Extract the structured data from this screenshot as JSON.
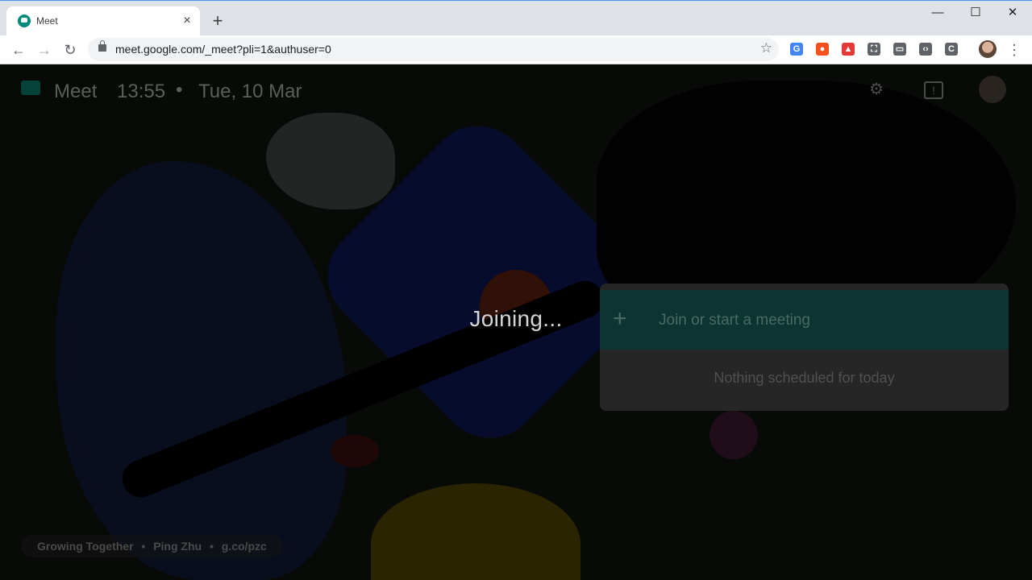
{
  "browser": {
    "tab_title": "Meet",
    "tab_close_icon": "×",
    "new_tab_icon": "+",
    "window_controls": {
      "minimize": "—",
      "maximize": "☐",
      "close": "✕"
    },
    "nav": {
      "back": "←",
      "forward": "→",
      "reload": "↻"
    },
    "url": "meet.google.com/_meet?pli=1&authuser=0",
    "bookmark_icon": "☆",
    "menu_icon": "⋮",
    "extensions": [
      {
        "name": "translate-extension-icon",
        "glyph": "G",
        "color": "#4285f4"
      },
      {
        "name": "orange-extension-icon",
        "glyph": "●",
        "color": "#f4511e"
      },
      {
        "name": "red-extension-icon",
        "glyph": "▲",
        "color": "#e53935"
      },
      {
        "name": "screenshot-extension-icon",
        "glyph": "⛶",
        "color": "#5f6368"
      },
      {
        "name": "chat-extension-icon",
        "glyph": "▭",
        "color": "#5f6368"
      },
      {
        "name": "code-extension-icon",
        "glyph": "‹›",
        "color": "#5f6368"
      },
      {
        "name": "c-extension-icon",
        "glyph": "C",
        "color": "#5f6368"
      }
    ]
  },
  "meet": {
    "app_name": "Meet",
    "time": "13:55",
    "separator": "•",
    "date": "Tue, 10 Mar",
    "settings_icon": "⚙",
    "feedback_icon": "!",
    "status": "Joining...",
    "join_icon": "+",
    "join_label": "Join or start a meeting",
    "schedule_empty": "Nothing scheduled for today",
    "credit": {
      "title": "Growing Together",
      "artist": "Ping Zhu",
      "link": "g.co/pzc",
      "separator": "•"
    }
  },
  "colors": {
    "accent": "#00796b",
    "chrome_bg": "#dee1e6"
  }
}
